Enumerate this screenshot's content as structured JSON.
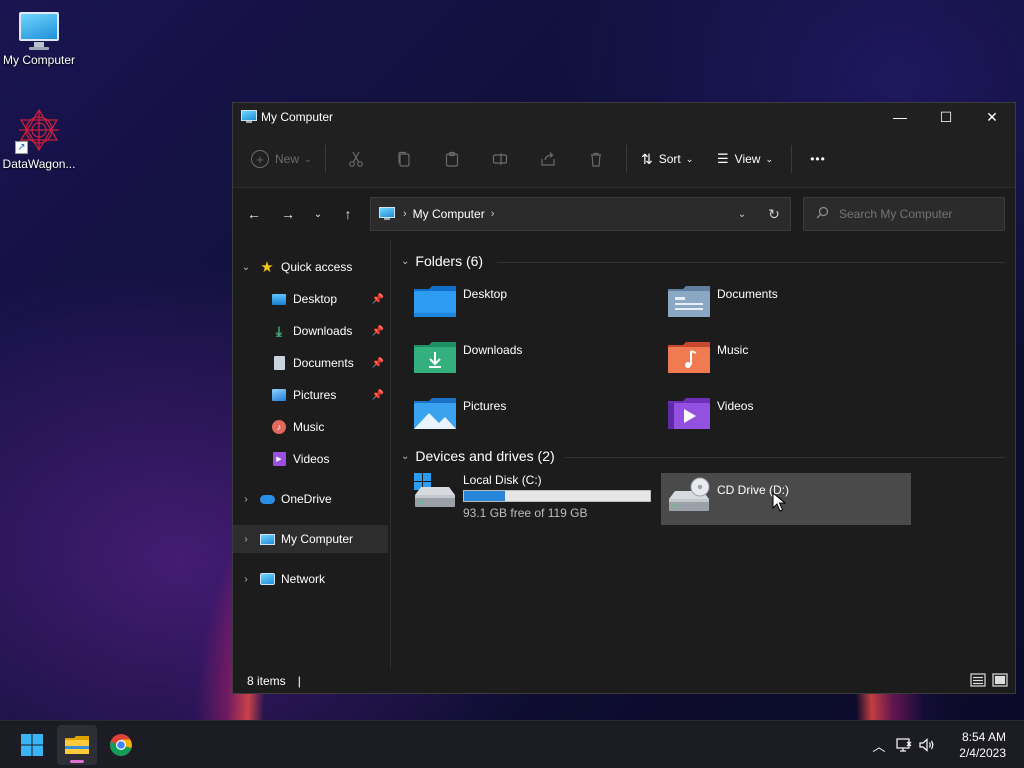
{
  "desktop": {
    "icons": [
      {
        "label": "My Computer",
        "icon": "monitor-icon"
      },
      {
        "label": "DataWagon...",
        "icon": "datawagon-logo-icon"
      }
    ]
  },
  "window": {
    "title": "My Computer",
    "controls": {
      "minimize": "—",
      "maximize": "☐",
      "close": "✕"
    }
  },
  "toolbar": {
    "new_label": "New",
    "sort_label": "Sort",
    "view_label": "View",
    "more_label": "•••"
  },
  "address": {
    "crumb": "My Computer",
    "separator": "›"
  },
  "search": {
    "placeholder": "Search My Computer"
  },
  "sidebar": {
    "quick_access": "Quick access",
    "items": [
      {
        "label": "Desktop",
        "pinned": true
      },
      {
        "label": "Downloads",
        "pinned": true
      },
      {
        "label": "Documents",
        "pinned": true
      },
      {
        "label": "Pictures",
        "pinned": true
      },
      {
        "label": "Music",
        "pinned": false
      },
      {
        "label": "Videos",
        "pinned": false
      }
    ],
    "onedrive": "OneDrive",
    "my_computer": "My Computer",
    "network": "Network"
  },
  "content": {
    "folders_header": "Folders (6)",
    "folders": [
      {
        "name": "Desktop",
        "icon": "desktop-folder-icon"
      },
      {
        "name": "Documents",
        "icon": "documents-folder-icon"
      },
      {
        "name": "Downloads",
        "icon": "downloads-folder-icon"
      },
      {
        "name": "Music",
        "icon": "music-folder-icon"
      },
      {
        "name": "Pictures",
        "icon": "pictures-folder-icon"
      },
      {
        "name": "Videos",
        "icon": "videos-folder-icon"
      }
    ],
    "devices_header": "Devices and drives (2)",
    "drives": [
      {
        "name": "Local Disk (C:)",
        "free_text": "93.1 GB free of 119 GB",
        "used_fraction": 0.22
      },
      {
        "name": "CD Drive (D:)"
      }
    ]
  },
  "status": {
    "items_count": "8 items",
    "pipe": "|"
  },
  "taskbar": {
    "time": "8:54 AM",
    "date": "2/4/2023"
  },
  "colors": {
    "accent": "#2684d9",
    "window_bg": "#1c1c1c",
    "selection": "#4a4a4a"
  }
}
